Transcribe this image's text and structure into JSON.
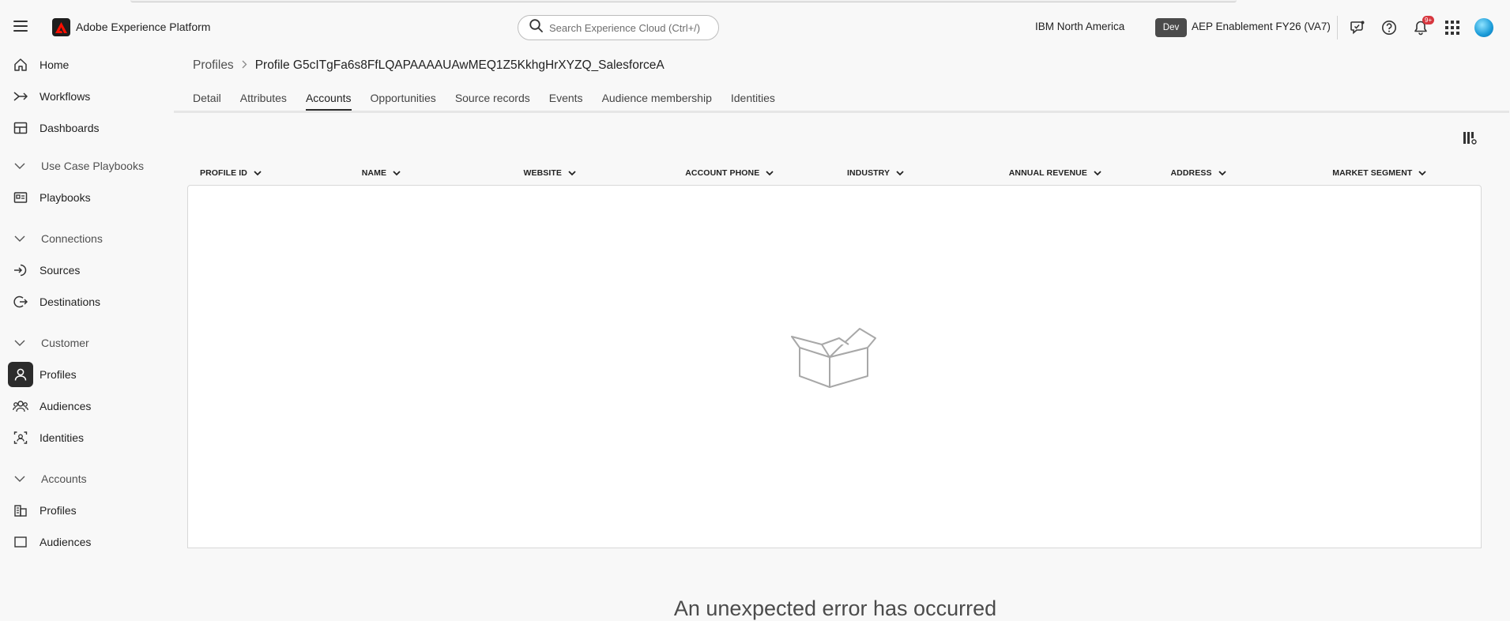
{
  "header": {
    "app_title": "Adobe Experience Platform",
    "search_placeholder": "Search Experience Cloud (Ctrl+/)",
    "org_name": "IBM North America",
    "env_badge": "Dev",
    "sandbox_name": "AEP Enablement FY26 (VA7)",
    "notification_count": "9+",
    "icons": [
      "menu-icon",
      "adobe-logo",
      "search-icon",
      "feedback-icon",
      "help-icon",
      "bell-icon",
      "apps-grid-icon",
      "avatar"
    ]
  },
  "sidebar": {
    "items": [
      {
        "label": "Home",
        "icon": "home-icon"
      },
      {
        "label": "Workflows",
        "icon": "workflow-icon"
      },
      {
        "label": "Dashboards",
        "icon": "dashboard-icon"
      },
      {
        "label": "Use Case Playbooks",
        "type": "section"
      },
      {
        "label": "Playbooks",
        "icon": "playbook-icon"
      },
      {
        "label": "Connections",
        "type": "section"
      },
      {
        "label": "Sources",
        "icon": "sources-icon"
      },
      {
        "label": "Destinations",
        "icon": "destinations-icon"
      },
      {
        "label": "Customer",
        "type": "section"
      },
      {
        "label": "Profiles",
        "icon": "profile-icon",
        "active": true
      },
      {
        "label": "Audiences",
        "icon": "audiences-icon"
      },
      {
        "label": "Identities",
        "icon": "identities-icon"
      },
      {
        "label": "Accounts",
        "type": "section"
      },
      {
        "label": "Profiles",
        "icon": "account-profiles-icon"
      },
      {
        "label": "Audiences",
        "icon": "account-audiences-icon"
      }
    ]
  },
  "breadcrumb": {
    "parent": "Profiles",
    "current": "Profile G5cITgFa6s8FfLQAPAAAAUAwMEQ1Z5KkhgHrXYZQ_SalesforceA"
  },
  "tabs": [
    "Detail",
    "Attributes",
    "Accounts",
    "Opportunities",
    "Source records",
    "Events",
    "Audience membership",
    "Identities"
  ],
  "active_tab": "Accounts",
  "table": {
    "columns": [
      "PROFILE ID",
      "NAME",
      "WEBSITE",
      "ACCOUNT PHONE",
      "INDUSTRY",
      "ANNUAL REVENUE",
      "ADDRESS",
      "MARKET SEGMENT"
    ],
    "rows": [],
    "empty_message": "An unexpected error has occurred"
  },
  "colors": {
    "active_nav_bg": "#2c2c2c",
    "notification_badge": "#d7373f",
    "page_bg": "#f8f8f8"
  }
}
